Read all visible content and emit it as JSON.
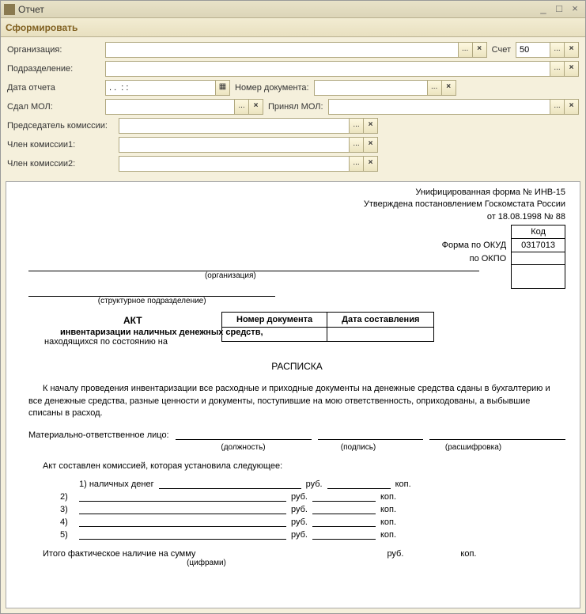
{
  "window": {
    "title": "Отчет"
  },
  "toolbar": {
    "generate": "Сформировать"
  },
  "filters": {
    "org_label": "Организация:",
    "subdiv_label": "Подразделение:",
    "date_label": "Дата отчета",
    "date_value": ". .  : :",
    "docnum_label": "Номер документа:",
    "account_label": "Счет",
    "account_value": "50",
    "gave_mol_label": "Сдал МОЛ:",
    "accepted_mol_label": "Принял МОЛ:",
    "chairman_label": "Председатель комиссии:",
    "member1_label": "Член комиссии1:",
    "member2_label": "Член комиссии2:"
  },
  "doc": {
    "form_ref": "Унифицированная форма № ИНВ-15",
    "approved": "Утверждена постановлением Госкомстата России",
    "decree": "от 18.08.1998 № 88",
    "code_hdr": "Код",
    "okud_label": "Форма по ОКУД",
    "okud_value": "0317013",
    "okpo_label": "по ОКПО",
    "org_caption": "(организация)",
    "subdiv_caption": "(структурное подразделение)",
    "col_docnum": "Номер документа",
    "col_date": "Дата составления",
    "akt": "АКТ",
    "akt_sub": "инвентаризации наличных денежных средств,",
    "akt_status": "находящихся по состоянию на",
    "receipt": "РАСПИСКА",
    "para": "К началу проведения инвентаризации все расходные и приходные документы на денежные средства сданы в бухгалтерию и все денежные средства, разные ценности и документы, поступившие на мою ответственность, оприходованы, а выбывшие списаны в расход.",
    "mol_label": "Материально-ответственное лицо:",
    "post_cap": "(должность)",
    "sign_cap": "(подпись)",
    "name_cap": "(расшифровка)",
    "kom_line": "Акт составлен комиссией, которая установила следующее:",
    "items": {
      "i1": "1) наличных денег",
      "i2": "2)",
      "i3": "3)",
      "i4": "4)",
      "i5": "5)"
    },
    "rub": "руб.",
    "kop": "коп.",
    "total": "Итого фактическое наличие на сумму",
    "digits_cap": "(цифрами)"
  }
}
